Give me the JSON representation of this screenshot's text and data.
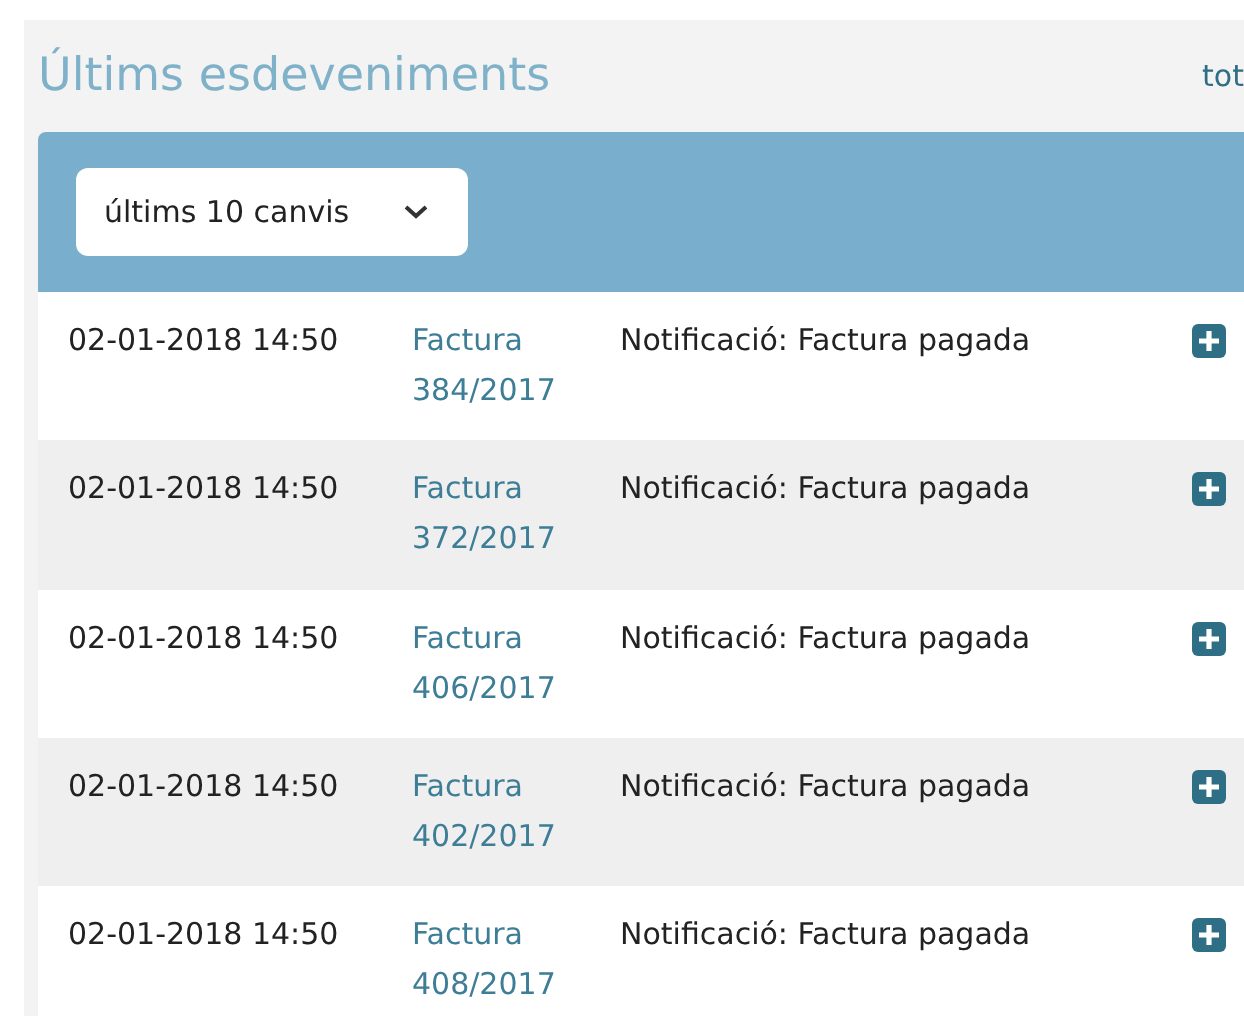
{
  "header": {
    "title": "Últims esdeveniments",
    "link": "tot"
  },
  "filter": {
    "value": "últims 10 canvis"
  },
  "events": [
    {
      "date": "02-01-2018 14:50",
      "link": "Factura 384/2017",
      "description": "Notificació: Factura pagada"
    },
    {
      "date": "02-01-2018 14:50",
      "link": "Factura 372/2017",
      "description": "Notificació: Factura pagada"
    },
    {
      "date": "02-01-2018 14:50",
      "link": "Factura 406/2017",
      "description": "Notificació: Factura pagada"
    },
    {
      "date": "02-01-2018 14:50",
      "link": "Factura 402/2017",
      "description": "Notificació: Factura pagada"
    },
    {
      "date": "02-01-2018 14:50",
      "link": "Factura 408/2017",
      "description": "Notificació: Factura pagada"
    }
  ]
}
